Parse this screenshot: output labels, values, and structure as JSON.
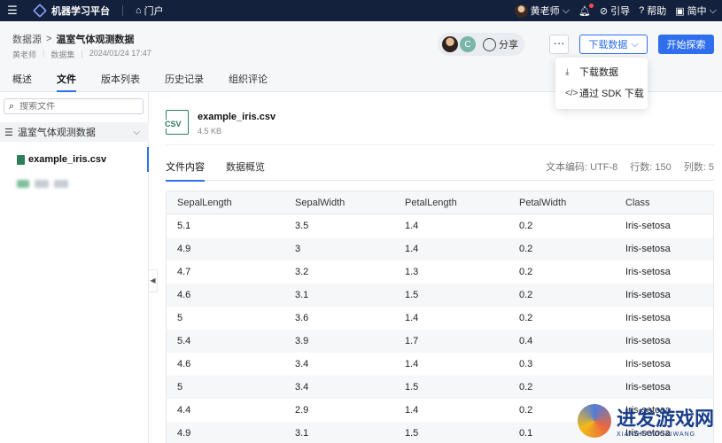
{
  "topbar": {
    "app_name": "机器学习平台",
    "portal_link": "门户",
    "user_name": "黄老师",
    "guide": "引导",
    "help": "帮助",
    "lang": "简中"
  },
  "header": {
    "breadcrumb_parent": "数据源",
    "breadcrumb_sep": ">",
    "title": "温室气体观测数据",
    "owner": "黄老师",
    "type": "数据集",
    "timestamp": "2024/01/24 17:47",
    "avatar_letter": "C",
    "share": "分享",
    "more": "···",
    "download": "下载数据",
    "start": "开始探索"
  },
  "dropdown": {
    "item1": "下载数据",
    "item2": "通过 SDK 下载"
  },
  "tabs": [
    "概述",
    "文件",
    "版本列表",
    "历史记录",
    "组织评论"
  ],
  "sidebar": {
    "search_placeholder": "搜索文件",
    "folder": "温室气体观测数据",
    "file": "example_iris.csv"
  },
  "file": {
    "icon_text": "CSV",
    "name": "example_iris.csv",
    "size": "4.5 KB"
  },
  "subtabs": [
    "文件内容",
    "数据概览"
  ],
  "stats": {
    "encoding": "文本编码: UTF-8",
    "rows": "行数: 150",
    "cols": "列数: 5"
  },
  "table": {
    "headers": [
      "SepalLength",
      "SepalWidth",
      "PetalLength",
      "PetalWidth",
      "Class"
    ],
    "rows": [
      [
        "5.1",
        "3.5",
        "1.4",
        "0.2",
        "Iris-setosa"
      ],
      [
        "4.9",
        "3",
        "1.4",
        "0.2",
        "Iris-setosa"
      ],
      [
        "4.7",
        "3.2",
        "1.3",
        "0.2",
        "Iris-setosa"
      ],
      [
        "4.6",
        "3.1",
        "1.5",
        "0.2",
        "Iris-setosa"
      ],
      [
        "5",
        "3.6",
        "1.4",
        "0.2",
        "Iris-setosa"
      ],
      [
        "5.4",
        "3.9",
        "1.7",
        "0.4",
        "Iris-setosa"
      ],
      [
        "4.6",
        "3.4",
        "1.4",
        "0.3",
        "Iris-setosa"
      ],
      [
        "5",
        "3.4",
        "1.5",
        "0.2",
        "Iris-setosa"
      ],
      [
        "4.4",
        "2.9",
        "1.4",
        "0.2",
        "Iris-setosa"
      ],
      [
        "4.9",
        "3.1",
        "1.5",
        "0.1",
        "Iris-setosa"
      ]
    ]
  },
  "watermark": {
    "title": "进发游戏网",
    "sub": "XIANGFAYOUXIWANG"
  },
  "colors": {
    "topbar": "#14213d",
    "accent": "#2f6fed"
  }
}
